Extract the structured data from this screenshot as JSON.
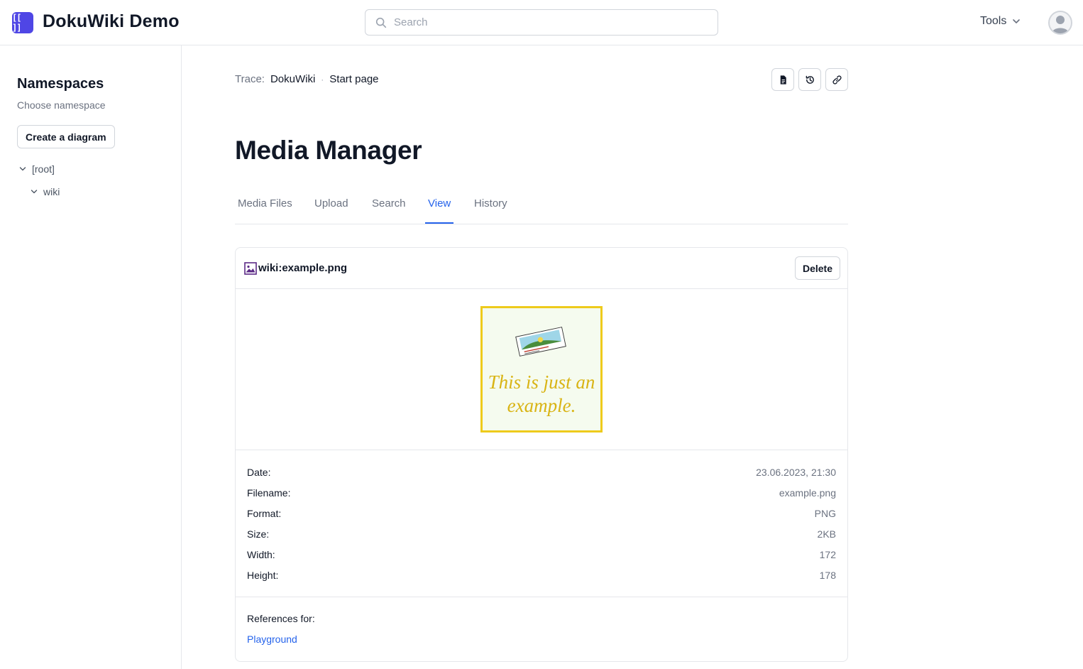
{
  "header": {
    "logo_text": "[[ ]]",
    "site_title": "DokuWiki Demo",
    "search_placeholder": "Search",
    "tools_label": "Tools"
  },
  "sidebar": {
    "title": "Namespaces",
    "subtitle": "Choose namespace",
    "create_button": "Create a diagram",
    "tree": [
      {
        "label": "[root]",
        "expanded": true
      },
      {
        "label": "wiki",
        "expanded": true
      }
    ]
  },
  "breadcrumb": {
    "label": "Trace:",
    "items": [
      "DokuWiki",
      "Start page"
    ],
    "separator": "·"
  },
  "page_tools": [
    "document-icon",
    "history-icon",
    "link-icon"
  ],
  "page_title": "Media Manager",
  "tabs": [
    {
      "label": "Media Files",
      "active": false
    },
    {
      "label": "Upload",
      "active": false
    },
    {
      "label": "Search",
      "active": false
    },
    {
      "label": "View",
      "active": true
    },
    {
      "label": "History",
      "active": false
    }
  ],
  "file": {
    "name": "wiki:example.png",
    "delete_label": "Delete",
    "preview_text": "This is just an example.",
    "meta": [
      {
        "label": "Date:",
        "value": "23.06.2023, 21:30"
      },
      {
        "label": "Filename:",
        "value": "example.png"
      },
      {
        "label": "Format:",
        "value": "PNG"
      },
      {
        "label": "Size:",
        "value": "2KB"
      },
      {
        "label": "Width:",
        "value": "172"
      },
      {
        "label": "Height:",
        "value": "178"
      }
    ],
    "references_label": "References for:",
    "references": [
      "Playground"
    ]
  },
  "colors": {
    "accent": "#2563eb",
    "logo": "#4f46e5",
    "preview_border": "#eecb1c"
  }
}
